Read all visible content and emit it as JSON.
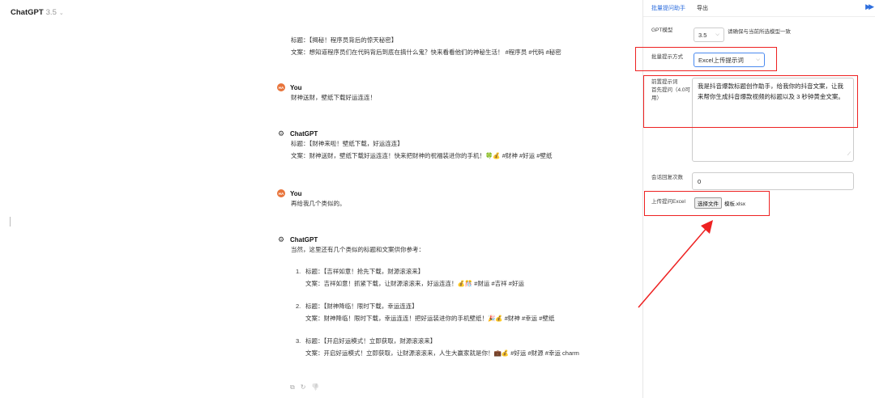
{
  "app": {
    "title": "ChatGPT",
    "version": "3.5",
    "chevron": "⌄"
  },
  "messages": [
    {
      "role": "assistant_partial",
      "lines": [
        "标题：【揭秘！程序员背后的惊天秘密】",
        "文案：想知道程序员们在代码背后到底在搞什么鬼？快来看看他们的神秘生活！ #程序员 #代码 #秘密"
      ]
    },
    {
      "role": "user",
      "avatar": "HA",
      "name": "You",
      "lines": [
        "财神送财，壁纸下载好运连连！"
      ]
    },
    {
      "role": "assistant",
      "name": "ChatGPT",
      "lines": [
        "标题：【财神来啦！壁纸下载，好运连连】",
        "文案：财神送财，壁纸下载好运连连！快来把财神的祝福装进你的手机！🍀💰 #财神 #好运 #壁纸"
      ]
    },
    {
      "role": "user",
      "avatar": "HA",
      "name": "You",
      "lines": [
        "再给我几个类似的。"
      ]
    },
    {
      "role": "assistant",
      "name": "ChatGPT",
      "intro": "当然，这里还有几个类似的标题和文案供你参考：",
      "items": [
        {
          "num": "1.",
          "title": "标题：【吉祥如意！抢先下载，财源滚滚来】",
          "text": "文案：吉祥如意！抓紧下载，让财源滚滚来，好运连连！💰🎊 #财运 #吉祥 #好运"
        },
        {
          "num": "2.",
          "title": "标题：【财神降临！限时下载，幸运连连】",
          "text": "文案：财神降临！限时下载，幸运连连！把好运装进你的手机壁纸！🎉💰 #财神 #幸运 #壁纸"
        },
        {
          "num": "3.",
          "title": "标题：【开启好运模式！立即获取，财源滚滚来】",
          "text": "文案：开启好运模式！立即获取，让财源滚滚来，人生大赢家就是你！💼💰 #好运 #财源 #幸运 charm"
        }
      ]
    }
  ],
  "message_actions": {
    "copy": "⧉",
    "regenerate": "↻",
    "dislike": "👎"
  },
  "panel": {
    "tabs": [
      {
        "label": "批量提问助手",
        "active": true
      },
      {
        "label": "导出",
        "active": false
      }
    ],
    "expand_icon": "▶▶",
    "gpt_model": {
      "label": "GPT模型",
      "value": "3.5",
      "hint": "请确保与当前所选模型一致"
    },
    "batch_mode": {
      "label": "批量提示方式",
      "value": "Excel上传提示词"
    },
    "prefix_prompt": {
      "label_line1": "前置提示词",
      "label_line2": "首先提问（4.0可用）",
      "value": "我是抖音爆款标题创作助手，给我你的抖音文案，让我来帮你生成抖音爆款视频的标题以及 3 秒钟黄金文案。"
    },
    "reply_count": {
      "label": "会话回复次数",
      "value": "0"
    },
    "upload": {
      "label": "上传提问Excel",
      "button": "选择文件",
      "filename": "模板.xlsx"
    }
  },
  "colors": {
    "accent": "#2f6fde",
    "annotation": "#e22222",
    "user_avatar": "#e8743b"
  }
}
